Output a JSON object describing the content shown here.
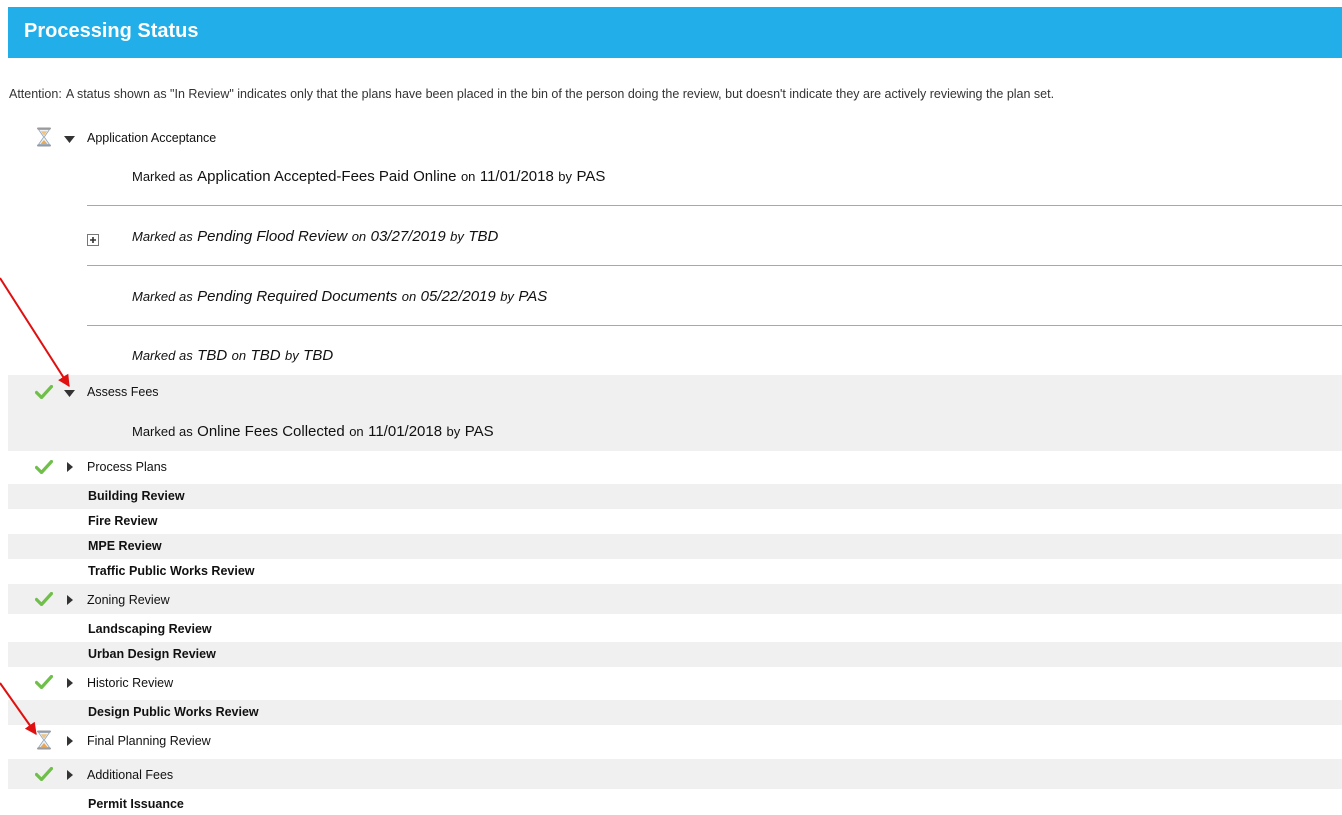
{
  "header": {
    "title": "Processing Status"
  },
  "attention": {
    "label": "Attention:",
    "text": "A status shown as \"In Review\" indicates only that the plans have been placed in the bin of the person doing the review, but doesn't indicate they are actively reviewing the plan set."
  },
  "tasks": {
    "application_acceptance": {
      "label": "Application Acceptance",
      "history": [
        {
          "prefix": "Marked as",
          "status": "Application Accepted-Fees Paid Online",
          "on": "on",
          "date": "11/01/2018",
          "by": "by",
          "person": "PAS"
        },
        {
          "prefix": "Marked as",
          "status": "Pending Flood Review",
          "on": "on",
          "date": "03/27/2019",
          "by": "by",
          "person": "TBD"
        },
        {
          "prefix": "Marked as",
          "status": "Pending Required Documents",
          "on": "on",
          "date": "05/22/2019",
          "by": "by",
          "person": "PAS"
        },
        {
          "prefix": "Marked as",
          "status": "TBD",
          "on": "on",
          "date": "TBD",
          "by": "by",
          "person": "TBD"
        }
      ]
    },
    "assess_fees": {
      "label": "Assess Fees",
      "history": [
        {
          "prefix": "Marked as",
          "status": "Online Fees Collected",
          "on": "on",
          "date": "11/01/2018",
          "by": "by",
          "person": "PAS"
        }
      ]
    },
    "process_plans": {
      "label": "Process Plans"
    },
    "building_review": {
      "label": "Building Review"
    },
    "fire_review": {
      "label": "Fire Review"
    },
    "mpe_review": {
      "label": "MPE Review"
    },
    "traffic_public_works_review": {
      "label": "Traffic Public Works Review"
    },
    "zoning_review": {
      "label": "Zoning Review"
    },
    "landscaping_review": {
      "label": "Landscaping Review"
    },
    "urban_design_review": {
      "label": "Urban Design Review"
    },
    "historic_review": {
      "label": "Historic Review"
    },
    "design_public_works_review": {
      "label": "Design Public Works Review"
    },
    "final_planning_review": {
      "label": "Final Planning Review"
    },
    "additional_fees": {
      "label": "Additional Fees"
    },
    "permit_issuance": {
      "label": "Permit Issuance"
    }
  },
  "colors": {
    "header_bg": "#22aee8",
    "check_green": "#6fbf4a",
    "row_shade": "#f0f0f0",
    "annotation_arrow": "#e01010"
  },
  "icons": {
    "in_progress": "hourglass-icon",
    "complete": "checkmark-icon",
    "expanded": "triangle-down-icon",
    "collapsed": "triangle-right-icon",
    "expand_detail": "plus-box-icon"
  }
}
